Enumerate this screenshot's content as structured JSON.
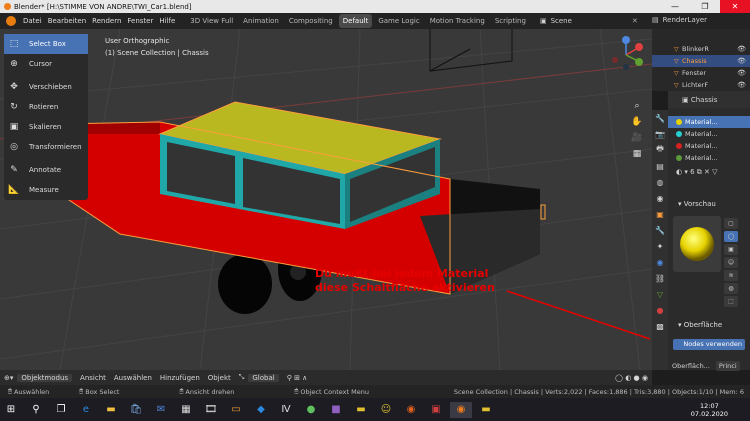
{
  "window": {
    "title": "Blender* [H:\\STIMME VON ANDRE\\TWI_Car1.blend]",
    "controls": [
      "—",
      "❐",
      "✕"
    ]
  },
  "menu": [
    "Datei",
    "Bearbeiten",
    "Rendern",
    "Fenster",
    "Hilfe"
  ],
  "workspaces": [
    "3D View Full",
    "Animation",
    "Compositing",
    "Default",
    "Game Logic",
    "Motion Tracking",
    "Scripting"
  ],
  "active_workspace": "Default",
  "scene": {
    "label": "Scene"
  },
  "render_layer": {
    "label": "RenderLayer"
  },
  "viewport": {
    "view_name": "User Orthographic",
    "collection": "(1) Scene Collection | Chassis"
  },
  "tools": [
    {
      "label": "Select Box",
      "icon": "select-box-icon",
      "active": true
    },
    {
      "label": "Cursor",
      "icon": "cursor-icon"
    },
    {
      "label": "Verschieben",
      "icon": "move-icon"
    },
    {
      "label": "Rotieren",
      "icon": "rotate-icon"
    },
    {
      "label": "Skalieren",
      "icon": "scale-icon"
    },
    {
      "label": "Transformieren",
      "icon": "transform-icon"
    },
    {
      "label": "Annotate",
      "icon": "annotate-icon"
    },
    {
      "label": "Measure",
      "icon": "measure-icon"
    }
  ],
  "annotation": {
    "line1": "Du mußt bei jedem Material",
    "line2": "diese Schaltfläche aktivieren",
    "color": "#e60000"
  },
  "viewport_header": {
    "mode": "Objektmodus",
    "items": [
      "Ansicht",
      "Auswählen",
      "Hinzufügen",
      "Objekt"
    ],
    "transform": "Global"
  },
  "statusbar": {
    "left": [
      "Auswählen",
      "Box Select",
      "Ansicht drehen",
      "Object Context Menu"
    ],
    "stats": "Scene Collection | Chassis | Verts:2,022 | Faces:1,886 | Tris:3,880 | Objects:1/10 | Mem: 6"
  },
  "outliner": {
    "rows": [
      {
        "name": "BlinkerR",
        "selected": false
      },
      {
        "name": "Chassis",
        "selected": true
      },
      {
        "name": "Fenster",
        "selected": false
      },
      {
        "name": "LichterF",
        "selected": false
      }
    ]
  },
  "properties": {
    "object_name": "Chassis",
    "materials": [
      {
        "name": "Material...",
        "color": "#e6d200",
        "selected": true
      },
      {
        "name": "Material...",
        "color": "#25d0d0"
      },
      {
        "name": "Material...",
        "color": "#d82020"
      },
      {
        "name": "Material...",
        "color": "#5a9a3a"
      }
    ],
    "preview_label": "Vorschau",
    "surface_label": "Oberfläche",
    "use_nodes_label": "Nodes verwenden",
    "surface_field_label": "Oberfläch...",
    "surface_field_value": "Princi"
  },
  "clock": {
    "time": "12:07",
    "date": "07.02.2020"
  },
  "colors": {
    "accent": "#4772b3",
    "body_red": "#d40000",
    "roof_yellow": "#b9b820",
    "cabin_teal": "#20a8a8",
    "outline": "#ff9e3d"
  }
}
